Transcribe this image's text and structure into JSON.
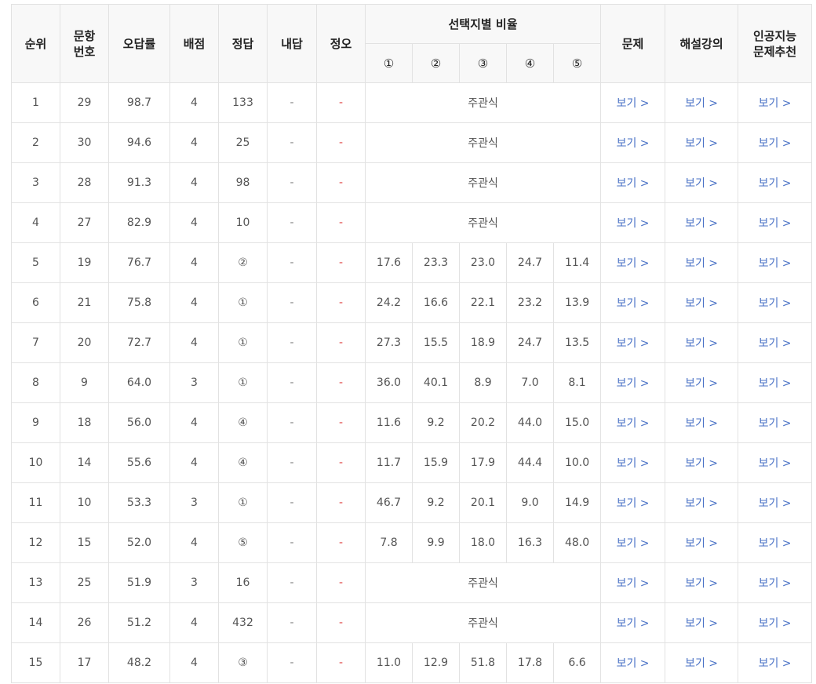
{
  "headers": {
    "rank": "순위",
    "qnum_line1": "문항",
    "qnum_line2": "번호",
    "wrong_rate": "오답률",
    "points": "배점",
    "answer": "정답",
    "my_answer": "내답",
    "correct_wrong": "정오",
    "choice_ratio": "선택지별 비율",
    "choices": [
      "①",
      "②",
      "③",
      "④",
      "⑤"
    ],
    "problem": "문제",
    "lecture": "해설강의",
    "ai_line1": "인공지능",
    "ai_line2": "문제추천"
  },
  "subjective_label": "주관식",
  "link_label": "보기 >",
  "rows": [
    {
      "rank": "1",
      "qnum": "29",
      "wrong_rate": "98.7",
      "points": "4",
      "answer": "133",
      "my_answer": "-",
      "ox": "-",
      "ratios": null
    },
    {
      "rank": "2",
      "qnum": "30",
      "wrong_rate": "94.6",
      "points": "4",
      "answer": "25",
      "my_answer": "-",
      "ox": "-",
      "ratios": null
    },
    {
      "rank": "3",
      "qnum": "28",
      "wrong_rate": "91.3",
      "points": "4",
      "answer": "98",
      "my_answer": "-",
      "ox": "-",
      "ratios": null
    },
    {
      "rank": "4",
      "qnum": "27",
      "wrong_rate": "82.9",
      "points": "4",
      "answer": "10",
      "my_answer": "-",
      "ox": "-",
      "ratios": null
    },
    {
      "rank": "5",
      "qnum": "19",
      "wrong_rate": "76.7",
      "points": "4",
      "answer": "②",
      "my_answer": "-",
      "ox": "-",
      "ratios": [
        "17.6",
        "23.3",
        "23.0",
        "24.7",
        "11.4"
      ]
    },
    {
      "rank": "6",
      "qnum": "21",
      "wrong_rate": "75.8",
      "points": "4",
      "answer": "①",
      "my_answer": "-",
      "ox": "-",
      "ratios": [
        "24.2",
        "16.6",
        "22.1",
        "23.2",
        "13.9"
      ]
    },
    {
      "rank": "7",
      "qnum": "20",
      "wrong_rate": "72.7",
      "points": "4",
      "answer": "①",
      "my_answer": "-",
      "ox": "-",
      "ratios": [
        "27.3",
        "15.5",
        "18.9",
        "24.7",
        "13.5"
      ]
    },
    {
      "rank": "8",
      "qnum": "9",
      "wrong_rate": "64.0",
      "points": "3",
      "answer": "①",
      "my_answer": "-",
      "ox": "-",
      "ratios": [
        "36.0",
        "40.1",
        "8.9",
        "7.0",
        "8.1"
      ]
    },
    {
      "rank": "9",
      "qnum": "18",
      "wrong_rate": "56.0",
      "points": "4",
      "answer": "④",
      "my_answer": "-",
      "ox": "-",
      "ratios": [
        "11.6",
        "9.2",
        "20.2",
        "44.0",
        "15.0"
      ]
    },
    {
      "rank": "10",
      "qnum": "14",
      "wrong_rate": "55.6",
      "points": "4",
      "answer": "④",
      "my_answer": "-",
      "ox": "-",
      "ratios": [
        "11.7",
        "15.9",
        "17.9",
        "44.4",
        "10.0"
      ]
    },
    {
      "rank": "11",
      "qnum": "10",
      "wrong_rate": "53.3",
      "points": "3",
      "answer": "①",
      "my_answer": "-",
      "ox": "-",
      "ratios": [
        "46.7",
        "9.2",
        "20.1",
        "9.0",
        "14.9"
      ]
    },
    {
      "rank": "12",
      "qnum": "15",
      "wrong_rate": "52.0",
      "points": "4",
      "answer": "⑤",
      "my_answer": "-",
      "ox": "-",
      "ratios": [
        "7.8",
        "9.9",
        "18.0",
        "16.3",
        "48.0"
      ]
    },
    {
      "rank": "13",
      "qnum": "25",
      "wrong_rate": "51.9",
      "points": "3",
      "answer": "16",
      "my_answer": "-",
      "ox": "-",
      "ratios": null
    },
    {
      "rank": "14",
      "qnum": "26",
      "wrong_rate": "51.2",
      "points": "4",
      "answer": "432",
      "my_answer": "-",
      "ox": "-",
      "ratios": null
    },
    {
      "rank": "15",
      "qnum": "17",
      "wrong_rate": "48.2",
      "points": "4",
      "answer": "③",
      "my_answer": "-",
      "ox": "-",
      "ratios": [
        "11.0",
        "12.9",
        "51.8",
        "17.8",
        "6.6"
      ]
    }
  ]
}
